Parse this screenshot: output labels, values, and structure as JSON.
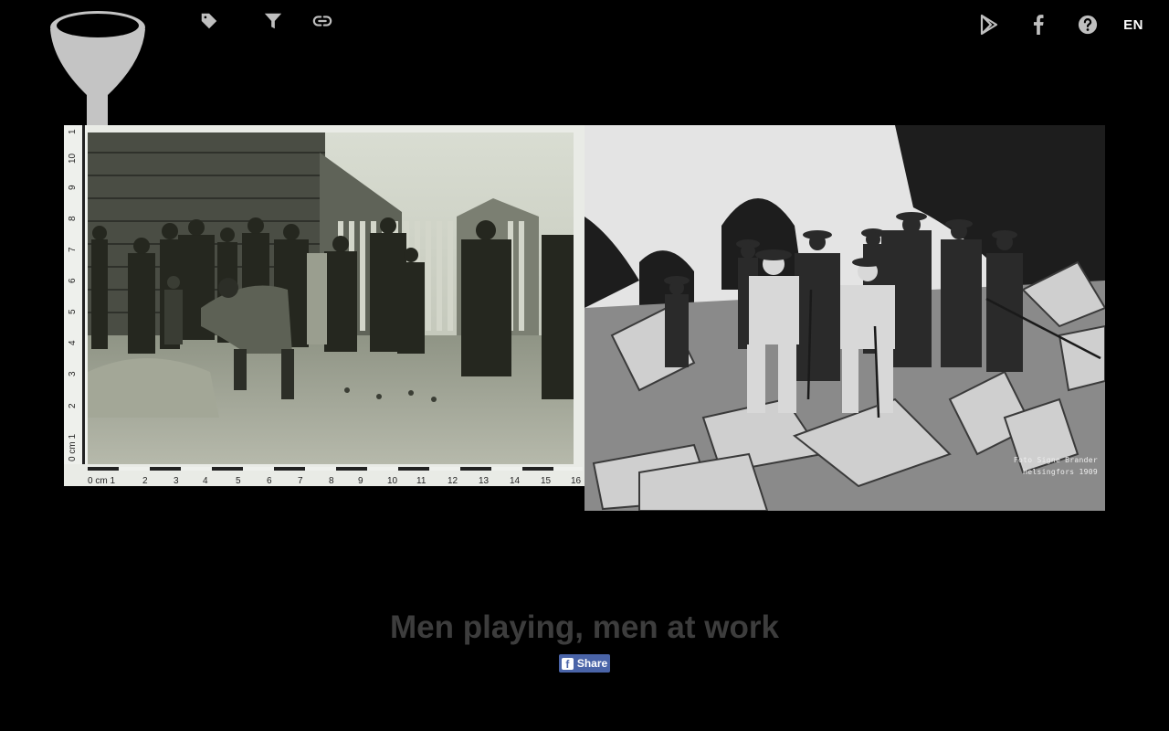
{
  "toolbar_left": {
    "icons": [
      "tag-icon",
      "filter-icon",
      "link-icon"
    ]
  },
  "toolbar_right": {
    "icons": [
      "play-store-icon",
      "facebook-icon",
      "help-icon"
    ],
    "language": "EN"
  },
  "photos": {
    "left": {
      "ruler_bottom_labels": [
        "0 cm 1",
        "2",
        "3",
        "4",
        "5",
        "6",
        "7",
        "8",
        "9",
        "10",
        "11",
        "12",
        "13",
        "14",
        "15",
        "16"
      ],
      "ruler_side_labels": [
        "0 cm 1",
        "2",
        "3",
        "4",
        "5",
        "6",
        "7",
        "8",
        "9",
        "10",
        "1"
      ]
    },
    "right": {
      "credit_line_1": "Foto Signe Brander",
      "credit_line_2": "Helsingfors 1909"
    }
  },
  "caption": {
    "title": "Men playing, men at work",
    "share_label": "Share",
    "share_icon_letter": "f"
  },
  "colors": {
    "background": "#000000",
    "icon": "#bfbfbf",
    "caption": "#3d3d3d",
    "share_button": "#4a64a8"
  }
}
